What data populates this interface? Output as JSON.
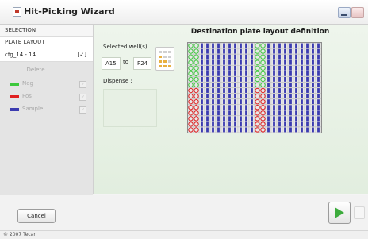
{
  "window": {
    "title": "Hit-Picking Wizard",
    "icon": "app-icon"
  },
  "sidebar": {
    "sections": [
      {
        "label": "SELECTION",
        "active": false
      },
      {
        "label": "PLATE LAYOUT",
        "active": true
      }
    ],
    "config": {
      "label": "cfg_14 - 14",
      "check": "[✓]",
      "delete_label": "Delete",
      "legend": [
        {
          "label": "Neg",
          "color": "#3cc83c",
          "checked": true
        },
        {
          "label": "Pos",
          "color": "#e02020",
          "checked": true
        },
        {
          "label": "Sample",
          "color": "#3b3bb0",
          "checked": true
        }
      ]
    }
  },
  "main": {
    "title": "Destination plate layout definition",
    "selected_wells_label": "Selected well(s)",
    "from_well": "A15",
    "to_label": "to",
    "to_well": "P24",
    "dispense_label": "Dispense :",
    "plate": {
      "rows": 16,
      "cols": 24,
      "colors": {
        "neg": "#3cc83c",
        "pos": "#e02020",
        "sample": "#3b3bb0"
      },
      "control_columns": [
        1,
        2,
        13,
        14
      ],
      "neg_row_range": [
        1,
        8
      ],
      "pos_row_range": [
        9,
        16
      ]
    }
  },
  "footer": {
    "cancel_label": "Cancel",
    "next_icon": "play-icon"
  },
  "status": {
    "copyright": "© 2007 Tecan"
  }
}
